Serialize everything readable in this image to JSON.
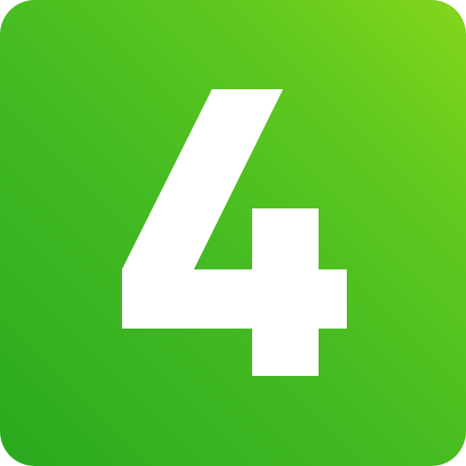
{
  "icon": {
    "name": "number-four-app-icon",
    "glyph": "4",
    "colors": {
      "gradient_start": "#2aa91f",
      "gradient_mid": "#44bb22",
      "gradient_end": "#84d61c",
      "glyph": "#ffffff"
    }
  }
}
